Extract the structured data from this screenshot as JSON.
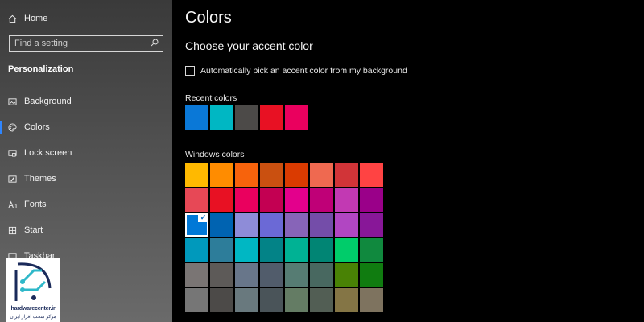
{
  "sidebar": {
    "home_label": "Home",
    "search_placeholder": "Find a setting",
    "section_title": "Personalization",
    "items": [
      {
        "label": "Background",
        "icon": "image-icon"
      },
      {
        "label": "Colors",
        "icon": "palette-icon",
        "selected": true
      },
      {
        "label": "Lock screen",
        "icon": "lock-screen-icon"
      },
      {
        "label": "Themes",
        "icon": "brush-icon"
      },
      {
        "label": "Fonts",
        "icon": "font-icon"
      },
      {
        "label": "Start",
        "icon": "start-icon"
      },
      {
        "label": "Taskbar",
        "icon": "taskbar-icon"
      }
    ]
  },
  "main": {
    "title": "Colors",
    "subtitle": "Choose your accent color",
    "auto_pick_label": "Automatically pick an accent color from my background",
    "recent_label": "Recent colors",
    "windows_label": "Windows colors",
    "recent_colors": [
      "#0a78d7",
      "#00b7c3",
      "#4c4a48",
      "#e81123",
      "#ea005e"
    ],
    "windows_colors": [
      "#ffb900",
      "#ff8c00",
      "#f7630c",
      "#ca5010",
      "#da3b01",
      "#ef6950",
      "#d13438",
      "#ff4343",
      "#e74856",
      "#e81123",
      "#ea005e",
      "#c30052",
      "#e3008c",
      "#bf0077",
      "#c239b3",
      "#9a0089",
      "#0078d7",
      "#0063b1",
      "#8e8cd8",
      "#6b69d6",
      "#8764b8",
      "#744da9",
      "#b146c2",
      "#881798",
      "#0099bc",
      "#2d7d9a",
      "#00b7c3",
      "#038387",
      "#00b294",
      "#018574",
      "#00cc6a",
      "#10893e",
      "#7a7574",
      "#5d5a58",
      "#68768a",
      "#515c6b",
      "#567c73",
      "#486860",
      "#498205",
      "#107c10",
      "#767676",
      "#4c4a48",
      "#69797e",
      "#4a5459",
      "#647c64",
      "#525e54",
      "#847545",
      "#7e735f"
    ],
    "selected_windows_index": 16
  },
  "watermark": {
    "brand": "hardwarecenter.ir",
    "brand_fa": "مرکز سخت افزار ایران"
  }
}
